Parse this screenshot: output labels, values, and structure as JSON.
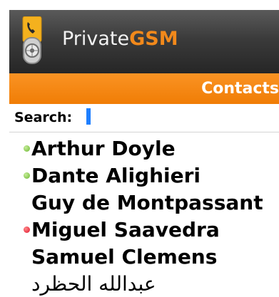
{
  "app": {
    "name_prefix": "Private",
    "name_suffix": "GSM",
    "accent_color": "#f2891b"
  },
  "screen": {
    "title": "Contacts",
    "title_bar_color": "#f5870f"
  },
  "search": {
    "label": "Search:",
    "value": "",
    "cursor_color": "#1e7fff"
  },
  "contacts": [
    {
      "name": "Arthur Doyle",
      "status": "green"
    },
    {
      "name": "Dante Alighieri",
      "status": "green"
    },
    {
      "name": "Guy de Montpassant",
      "status": "none"
    },
    {
      "name": "Miguel Saavedra",
      "status": "red"
    },
    {
      "name": "Samuel Clemens",
      "status": "none"
    },
    {
      "name": "عبدالله الحظرد",
      "status": "none"
    }
  ],
  "status_colors": {
    "green": "#6ab52f",
    "red": "#e0102a"
  },
  "icons": {
    "logo": "phone-lock-icon",
    "online": "status-dot-icon"
  }
}
